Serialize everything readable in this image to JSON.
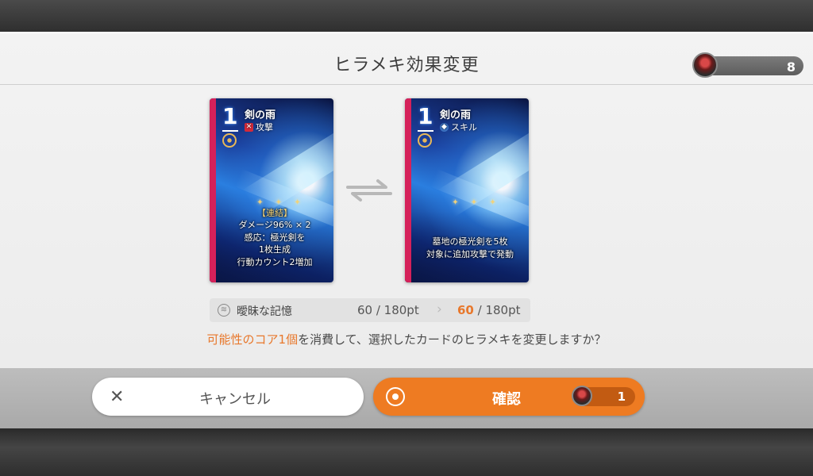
{
  "dialog": {
    "title": "ヒラメキ効果変更",
    "core_count": "8"
  },
  "card_before": {
    "cost": "1",
    "name": "剣の雨",
    "type_label": "攻撃",
    "sparkle": "✦ ✦ ✦",
    "desc_lines": [
      "【連結】",
      "ダメージ96% × 2",
      "感応：極光剣を",
      "1枚生成",
      "行動カウント2増加"
    ]
  },
  "card_after": {
    "cost": "1",
    "name": "剣の雨",
    "type_label": "スキル",
    "sparkle": "✦ ✦ ✦",
    "desc_lines": [
      "墓地の極光剣を5枚",
      "対象に追加攻撃で発動"
    ]
  },
  "stat": {
    "label": "曖昧な記憶",
    "before": "60 / 180pt",
    "after_current": "60",
    "after_rest": " / 180pt"
  },
  "question": {
    "accent": "可能性のコア1個",
    "rest": "を消費して、選択したカードのヒラメキを変更しますか？"
  },
  "buttons": {
    "cancel_label": "キャンセル",
    "confirm_label": "確認",
    "confirm_cost": "1"
  },
  "colors": {
    "accent_orange": "#ee7b22",
    "card_stripe": "#d5215a"
  }
}
